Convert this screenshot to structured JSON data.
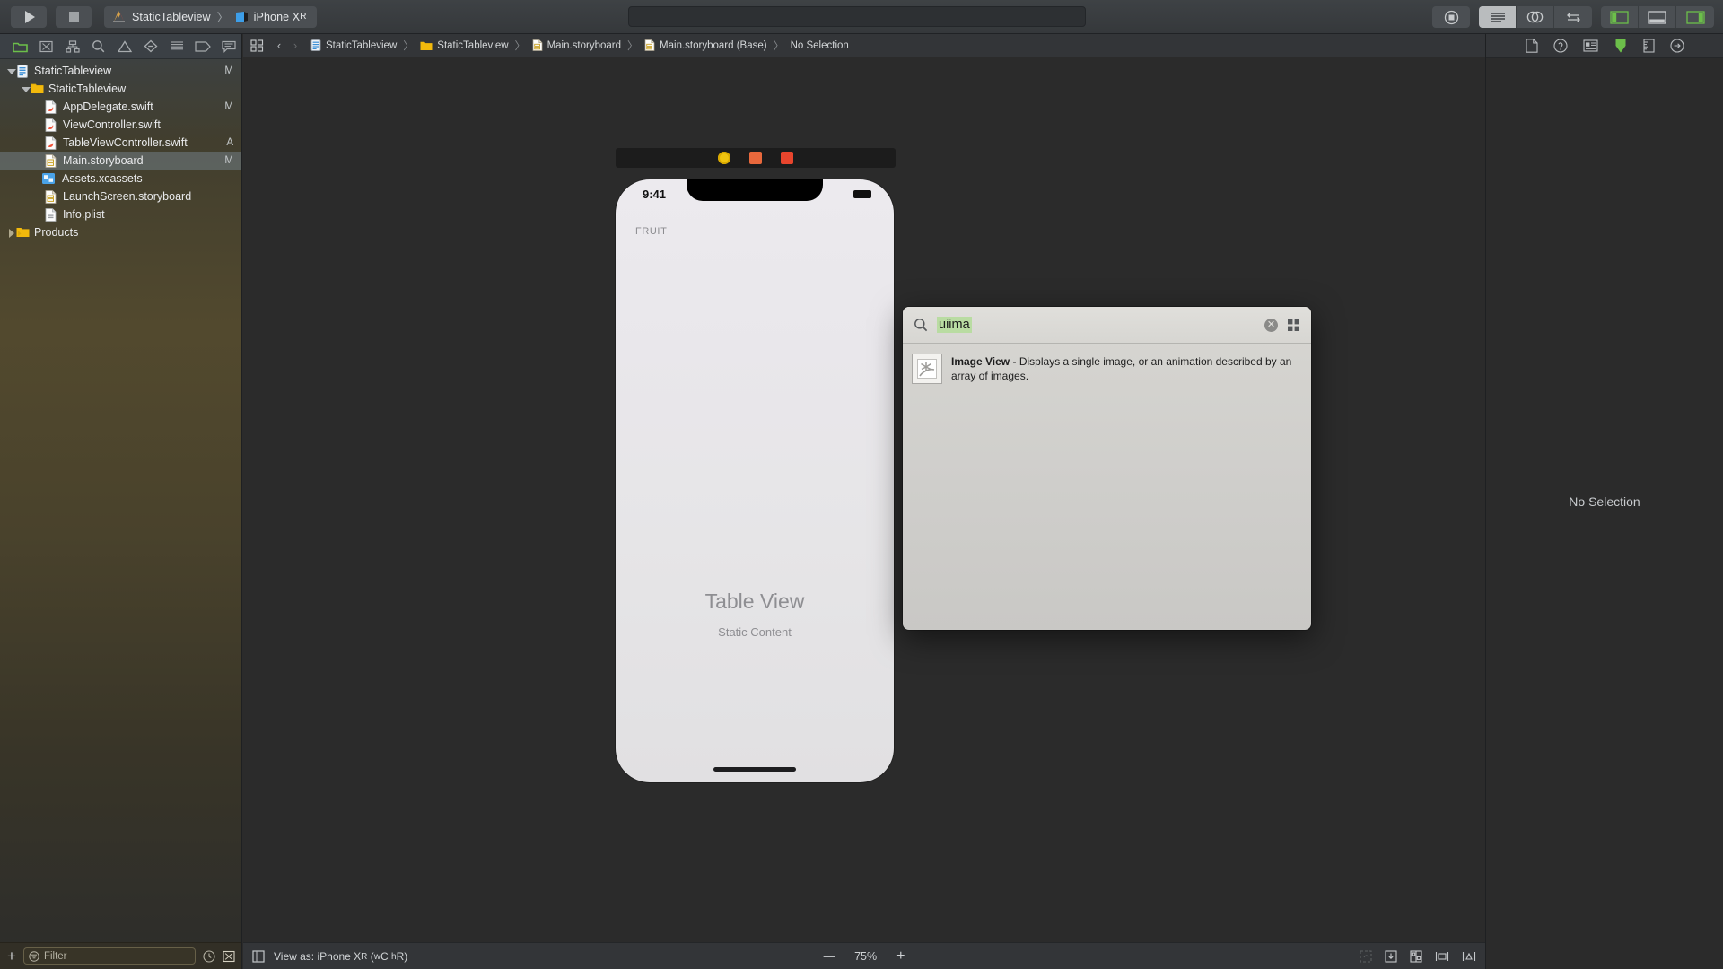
{
  "toolbar": {
    "run_button": "run",
    "stop_button": "stop",
    "scheme_name": "StaticTableview",
    "scheme_separator": "〉",
    "destination_name": "iPhone X",
    "destination_suffix": "R",
    "search_placeholder": "",
    "library_button": "library-icon",
    "editor_modes": [
      "standard-editor",
      "assistant-editor",
      "version-editor"
    ],
    "panel_toggles": [
      "navigator-toggle",
      "debug-toggle",
      "inspector-toggle"
    ]
  },
  "navigator": {
    "tabs": [
      "project-navigator",
      "source-control-navigator",
      "symbol-navigator",
      "find-navigator",
      "issue-navigator",
      "test-navigator",
      "debug-navigator",
      "breakpoint-navigator",
      "report-navigator"
    ],
    "items": [
      {
        "label": "StaticTableview",
        "indent": 0,
        "icon": "project-icon",
        "twisty": "down",
        "status": "M",
        "selected": false
      },
      {
        "label": "StaticTableview",
        "indent": 1,
        "icon": "folder-icon",
        "twisty": "down",
        "status": "",
        "selected": false
      },
      {
        "label": "AppDelegate.swift",
        "indent": 2,
        "icon": "swift-icon",
        "twisty": "none",
        "status": "M",
        "selected": false
      },
      {
        "label": "ViewController.swift",
        "indent": 2,
        "icon": "swift-icon",
        "twisty": "none",
        "status": "",
        "selected": false
      },
      {
        "label": "TableViewController.swift",
        "indent": 2,
        "icon": "swift-icon",
        "twisty": "none",
        "status": "A",
        "selected": false
      },
      {
        "label": "Main.storyboard",
        "indent": 2,
        "icon": "storyboard-icon",
        "twisty": "none",
        "status": "M",
        "selected": true
      },
      {
        "label": "Assets.xcassets",
        "indent": 2,
        "icon": "assets-icon",
        "twisty": "none",
        "status": "",
        "selected": false
      },
      {
        "label": "LaunchScreen.storyboard",
        "indent": 2,
        "icon": "storyboard-icon",
        "twisty": "none",
        "status": "",
        "selected": false
      },
      {
        "label": "Info.plist",
        "indent": 2,
        "icon": "plist-icon",
        "twisty": "none",
        "status": "",
        "selected": false
      },
      {
        "label": "Products",
        "indent": 0,
        "icon": "folder-icon",
        "twisty": "right",
        "status": "",
        "selected": false
      }
    ],
    "filter_placeholder": "Filter",
    "add_button": "+"
  },
  "jumpbar": {
    "back": "‹",
    "forward": "›",
    "crumbs": [
      {
        "label": "StaticTableview",
        "icon": "project-icon"
      },
      {
        "label": "StaticTableview",
        "icon": "folder-icon"
      },
      {
        "label": "Main.storyboard",
        "icon": "storyboard-icon"
      },
      {
        "label": "Main.storyboard (Base)",
        "icon": "storyboard-icon"
      },
      {
        "label": "No Selection",
        "icon": ""
      }
    ],
    "separator": "〉"
  },
  "canvas": {
    "device": {
      "status_time": "9:41",
      "section_header": "FRUIT",
      "table_title": "Table View",
      "table_subtitle": "Static Content",
      "toolbar_icons": [
        "view-controller-icon",
        "first-responder-icon",
        "exit-icon"
      ]
    }
  },
  "library": {
    "query": "uiima",
    "clear_label": "✕",
    "grid_toggle": "grid-view-icon",
    "results": [
      {
        "title": "Image View",
        "dash": "-",
        "description": "Displays a single image, or an animation described by an array of images.",
        "icon": "image-view-icon"
      }
    ]
  },
  "inspector": {
    "tabs": [
      "file-inspector",
      "quick-help-inspector",
      "identity-inspector",
      "attributes-inspector",
      "size-inspector",
      "connections-inspector"
    ],
    "active_tab": "attributes-inspector",
    "empty_message": "No Selection"
  },
  "statusbar": {
    "canvas_toggle": "canvas-toggle-icon",
    "view_as_label": "View as: iPhone X",
    "view_as_suffix": "R",
    "view_as_traits_open": "(",
    "view_as_traits_w": "w",
    "view_as_traits_wc": "C",
    "view_as_traits_h": "h",
    "view_as_traits_hr": "R",
    "view_as_traits_close": ")",
    "zoom_out": "—",
    "zoom_level": "75%",
    "zoom_in": "+",
    "tools": [
      "update-frames-icon",
      "embed-in-icon",
      "align-icon",
      "pin-icon",
      "resolve-issues-icon"
    ]
  },
  "colors": {
    "accent_green": "#66bb4a",
    "highlight_green": "#b9dca2",
    "selection": "#6e7a82",
    "folder_yellow": "#f0b90f"
  }
}
